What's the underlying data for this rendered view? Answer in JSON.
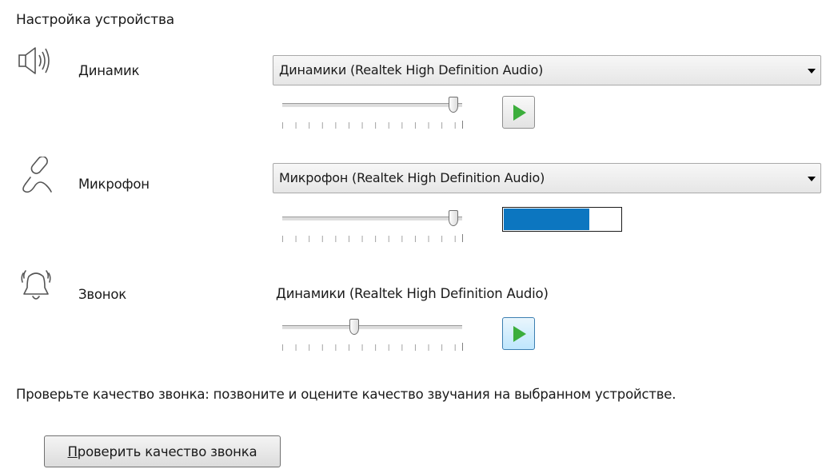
{
  "section_title": "Настройка устройства",
  "colors": {
    "play_green": "#3cae3c",
    "meter_blue": "#0c76c0"
  },
  "speaker": {
    "icon": "speaker-icon",
    "label": "Динамик",
    "device": "Динамики (Realtek High Definition Audio)",
    "volume_fraction": 0.95
  },
  "microphone": {
    "icon": "microphone-icon",
    "label": "Микрофон",
    "device": "Микрофон (Realtek High Definition Audio)",
    "volume_fraction": 0.95,
    "input_level_fraction": 0.73
  },
  "ringer": {
    "icon": "bell-icon",
    "label": "Звонок",
    "device": "Динамики (Realtek High Definition Audio)",
    "volume_fraction": 0.4
  },
  "test_call": {
    "hint": "Проверьте качество звонка: позвоните и оцените качество звучания на выбранном устройстве.",
    "button_label_accel": "П",
    "button_label_rest": "роверить качество звонка"
  }
}
